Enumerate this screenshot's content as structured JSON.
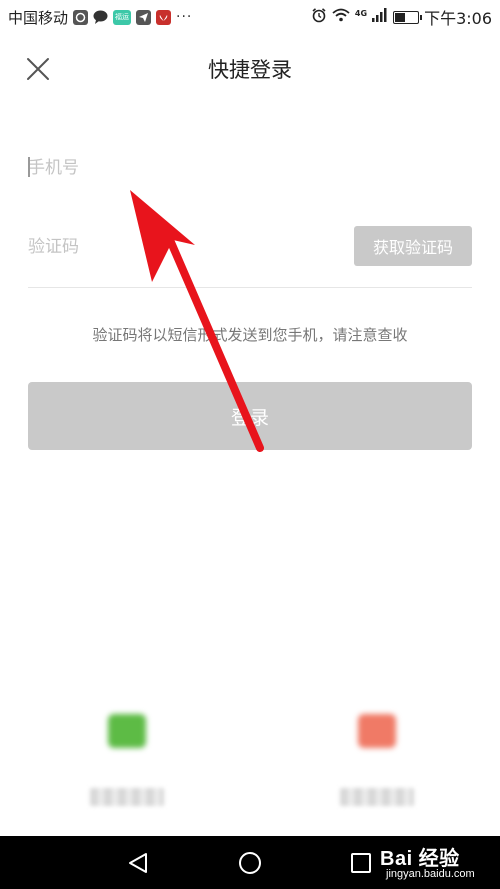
{
  "status_bar": {
    "carrier": "中国移动",
    "network": "4G",
    "time": "下午3:06",
    "more": "···",
    "icons": [
      "gallery-icon",
      "chat-icon",
      "badge-icon",
      "send-icon",
      "huawei-icon",
      "alarm-icon",
      "wifi-icon",
      "signal-icon",
      "battery-icon"
    ],
    "icon_badge_text": "福运"
  },
  "header": {
    "title": "快捷登录",
    "close_icon": "close-icon"
  },
  "form": {
    "phone_placeholder": "手机号",
    "code_placeholder": "验证码",
    "get_code_label": "获取验证码",
    "hint": "验证码将以短信形式发送到您手机，请注意查收",
    "login_label": "登录"
  },
  "nav_bar": {
    "back_icon": "back-triangle-icon",
    "home_icon": "home-circle-icon",
    "recent_icon": "recent-square-icon"
  },
  "watermark": {
    "brand": "Bai 经验",
    "url": "jingyan.baidu.com"
  },
  "colors": {
    "button_disabled": "#c9c9c9",
    "annotation_arrow": "#e8141c",
    "divider": "#e6e6e6",
    "nav_bar": "#000000"
  }
}
